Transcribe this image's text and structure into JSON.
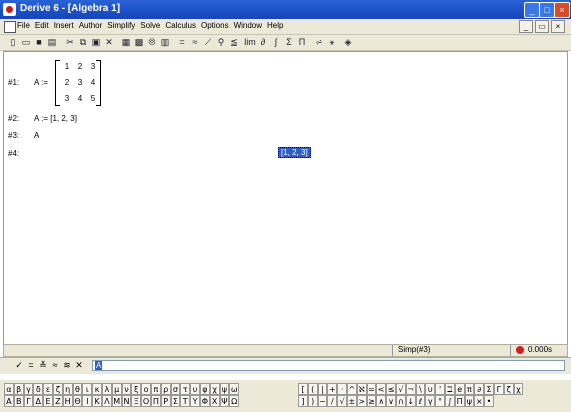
{
  "window": {
    "title": "Derive 6 - [Algebra 1]",
    "controls": [
      "_",
      "□",
      "×"
    ]
  },
  "menubar": {
    "items": [
      "File",
      "Edit",
      "Insert",
      "Author",
      "Simplify",
      "Solve",
      "Calculus",
      "Options",
      "Window",
      "Help"
    ],
    "mdi_controls": [
      "_",
      "▭",
      "×"
    ]
  },
  "toolbar": {
    "buttons": [
      {
        "name": "new-icon",
        "glyph": "▯"
      },
      {
        "name": "open-icon",
        "glyph": "▭"
      },
      {
        "name": "save-icon",
        "glyph": "■"
      },
      {
        "name": "print-icon",
        "glyph": "▤"
      },
      {
        "name": "cut-icon",
        "glyph": "✂"
      },
      {
        "name": "copy-icon",
        "glyph": "⧉"
      },
      {
        "name": "paste-icon",
        "glyph": "▣"
      },
      {
        "name": "delete-icon",
        "glyph": "✕"
      },
      {
        "name": "text-object-icon",
        "glyph": "▦"
      },
      {
        "name": "edit-icon",
        "glyph": "▩"
      },
      {
        "name": "vector-icon",
        "glyph": "⦾"
      },
      {
        "name": "matrix-icon",
        "glyph": "▥"
      },
      {
        "name": "simplify-icon",
        "glyph": "="
      },
      {
        "name": "approximate-icon",
        "glyph": "≈"
      },
      {
        "name": "plot-icon",
        "glyph": "⟋"
      },
      {
        "name": "zoom-icon",
        "glyph": "⚲"
      },
      {
        "name": "substitute-icon",
        "glyph": "≦"
      },
      {
        "name": "limit-icon",
        "glyph": "lim"
      },
      {
        "name": "derivative-icon",
        "glyph": "∂"
      },
      {
        "name": "integral-icon",
        "glyph": "∫"
      },
      {
        "name": "sum-icon",
        "glyph": "Σ"
      },
      {
        "name": "product-icon",
        "glyph": "Π"
      },
      {
        "name": "taylor-icon",
        "glyph": "⩫"
      },
      {
        "name": "solve-icon",
        "glyph": "⚹"
      },
      {
        "name": "book-icon",
        "glyph": "◈"
      }
    ]
  },
  "expressions": [
    {
      "label": "#1:",
      "lhs": "A :=",
      "matrix": [
        [
          "1",
          "2",
          "3"
        ],
        [
          "2",
          "3",
          "4"
        ],
        [
          "3",
          "4",
          "5"
        ]
      ]
    },
    {
      "label": "#2:",
      "text": "A := [1, 2, 3]"
    },
    {
      "label": "#3:",
      "text": "A"
    },
    {
      "label": "#4:",
      "result": "[1, 2, 3]"
    }
  ],
  "statusbar": {
    "text": "Simp(#3)",
    "time": "0.000s"
  },
  "entry": {
    "buttons": [
      {
        "name": "enter-icon",
        "glyph": "✓"
      },
      {
        "name": "simplify-icon",
        "glyph": "="
      },
      {
        "name": "enter-simplify-icon",
        "glyph": "≚"
      },
      {
        "name": "approx-icon",
        "glyph": "≈"
      },
      {
        "name": "enter-approx-icon",
        "glyph": "≋"
      },
      {
        "name": "cancel-icon",
        "glyph": "✕"
      }
    ],
    "value": "A"
  },
  "greek_lower": [
    "α",
    "β",
    "γ",
    "δ",
    "ε",
    "ζ",
    "η",
    "θ",
    "ι",
    "κ",
    "λ",
    "μ",
    "ν",
    "ξ",
    "ο",
    "π",
    "ρ",
    "σ",
    "τ",
    "υ",
    "φ",
    "χ",
    "ψ",
    "ω"
  ],
  "greek_upper": [
    "Α",
    "Β",
    "Γ",
    "Δ",
    "Ε",
    "Ζ",
    "Η",
    "Θ",
    "Ι",
    "Κ",
    "Λ",
    "Μ",
    "Ν",
    "Ξ",
    "Ο",
    "Π",
    "Ρ",
    "Σ",
    "Τ",
    "Υ",
    "Φ",
    "Χ",
    "Ψ",
    "Ω"
  ],
  "symbols_row1": [
    "[",
    "(",
    "|",
    "+",
    "·",
    "^",
    "ℵ",
    "=",
    "<",
    "≤",
    "√",
    "¬",
    "\\",
    "∪",
    "'",
    "ℶ",
    "e",
    "π",
    "∂",
    "Σ",
    "Γ",
    "ζ",
    "χ"
  ],
  "symbols_row2": [
    "]",
    ")",
    "−",
    "/",
    "√",
    "±",
    ">",
    "≥",
    "∧",
    "∨",
    "∩",
    "↓",
    "ℓ",
    "γ",
    "°",
    "∫",
    "Π",
    "ψ",
    "×",
    "•"
  ]
}
